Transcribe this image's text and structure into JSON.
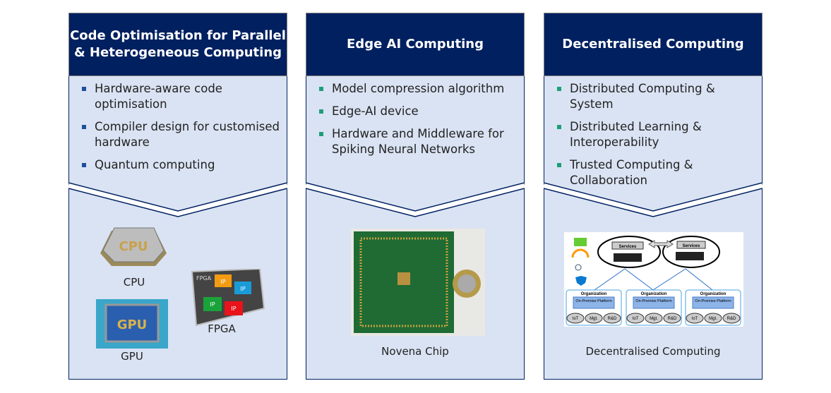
{
  "colors": {
    "header": "#002060",
    "panel": "#dae3f3",
    "bullet_blue": "#1f4e9c",
    "bullet_green": "#1e9e78"
  },
  "panels": [
    {
      "title": "Code Optimisation for Parallel & Heterogeneous Computing",
      "bullets": [
        "Hardware-aware code optimisation",
        "Compiler design for customised hardware",
        "Quantum computing"
      ],
      "captions": {
        "cpu": "CPU",
        "gpu": "GPU",
        "fpga": "FPGA"
      },
      "chip_labels": {
        "cpu": "CPU",
        "gpu": "GPU",
        "fpga": "FPGA",
        "ip": "IP"
      }
    },
    {
      "title": "Edge AI Computing",
      "bullets": [
        "Model compression algorithm",
        "Edge-AI device",
        "Hardware and Middleware for Spiking Neural Networks"
      ],
      "caption": "Novena Chip"
    },
    {
      "title": "Decentralised Computing",
      "bullets": [
        "Distributed Computing & System",
        "Distributed Learning & Interoperability",
        "Trusted Computing & Collaboration"
      ],
      "caption": "Decentralised Computing",
      "diagram": {
        "services": "Services",
        "organization": "Organization",
        "platform": "On-Premise Platform",
        "nodes": [
          "IoT",
          "Mgt.",
          "R&D"
        ]
      }
    }
  ]
}
